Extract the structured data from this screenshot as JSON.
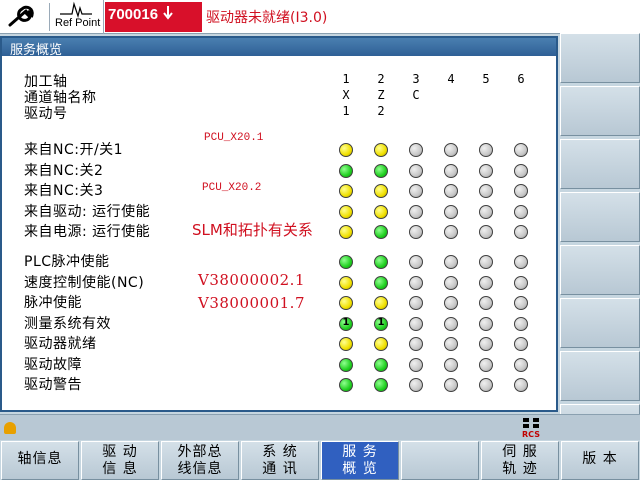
{
  "topbar": {
    "refpoint_label": "Ref Point",
    "alarm_code": "700016",
    "alarm_text": "驱动器未就绪(I3.0)"
  },
  "window": {
    "title": "服务概览"
  },
  "header_rows": [
    "加工轴",
    "通道轴名称",
    "驱动号"
  ],
  "columns": [
    {
      "num": "1",
      "axis": "X",
      "drive": "1"
    },
    {
      "num": "2",
      "axis": "Z",
      "drive": "2"
    },
    {
      "num": "3",
      "axis": "C",
      "drive": ""
    },
    {
      "num": "4",
      "axis": "",
      "drive": ""
    },
    {
      "num": "5",
      "axis": "",
      "drive": ""
    },
    {
      "num": "6",
      "axis": "",
      "drive": ""
    }
  ],
  "status_rows": [
    {
      "label": "来自NC:开/关1",
      "leds": [
        "yellow",
        "yellow",
        "gray",
        "gray",
        "gray",
        "gray"
      ]
    },
    {
      "label": "来自NC:关2",
      "leds": [
        "green",
        "green",
        "gray",
        "gray",
        "gray",
        "gray"
      ]
    },
    {
      "label": "来自NC:关3",
      "leds": [
        "yellow",
        "yellow",
        "gray",
        "gray",
        "gray",
        "gray"
      ]
    },
    {
      "label": "来自驱动: 运行使能",
      "leds": [
        "yellow",
        "yellow",
        "gray",
        "gray",
        "gray",
        "gray"
      ]
    },
    {
      "label": "来自电源: 运行使能",
      "leds": [
        "yellow",
        "green",
        "gray",
        "gray",
        "gray",
        "gray"
      ]
    },
    {
      "label": "PLC脉冲使能",
      "leds": [
        "green",
        "green",
        "gray",
        "gray",
        "gray",
        "gray"
      ]
    },
    {
      "label": "速度控制使能(NC)",
      "leds": [
        "yellow",
        "green",
        "gray",
        "gray",
        "gray",
        "gray"
      ]
    },
    {
      "label": "脉冲使能",
      "leds": [
        "yellow",
        "yellow",
        "gray",
        "gray",
        "gray",
        "gray"
      ]
    },
    {
      "label": "测量系统有效",
      "leds": [
        "green",
        "green",
        "gray",
        "gray",
        "gray",
        "gray"
      ],
      "led_text": [
        "1",
        "1",
        "",
        "",
        "",
        ""
      ]
    },
    {
      "label": "驱动器就绪",
      "leds": [
        "yellow",
        "yellow",
        "gray",
        "gray",
        "gray",
        "gray"
      ]
    },
    {
      "label": "驱动故障",
      "leds": [
        "green",
        "green",
        "gray",
        "gray",
        "gray",
        "gray"
      ]
    },
    {
      "label": "驱动警告",
      "leds": [
        "green",
        "green",
        "gray",
        "gray",
        "gray",
        "gray"
      ]
    }
  ],
  "annotations": {
    "pcu1": "PCU_X20.1",
    "pcu2": "PCU_X20.2",
    "slm": "SLM和拓扑有关系",
    "v2": "V38000002.1",
    "v1": "V38000001.7"
  },
  "status_icon_text": "RCS",
  "softkeys": [
    {
      "line1": "轴信息",
      "line2": "",
      "active": false
    },
    {
      "line1": "驱 动",
      "line2": "信 息",
      "active": false
    },
    {
      "line1": "外部总",
      "line2": "线信息",
      "active": false
    },
    {
      "line1": "系 统",
      "line2": "通 讯",
      "active": false
    },
    {
      "line1": "服 务",
      "line2": "概 览",
      "active": true
    },
    {
      "line1": "",
      "line2": "",
      "active": false
    },
    {
      "line1": "伺 服",
      "line2": "轨 迹",
      "active": false
    },
    {
      "line1": "版 本",
      "line2": "",
      "active": false
    }
  ],
  "colors": {
    "alarm_bg": "#d8102a",
    "annotation": "#d01020",
    "active_softkey": "#3060c0",
    "title_bar": "#2f6096"
  }
}
